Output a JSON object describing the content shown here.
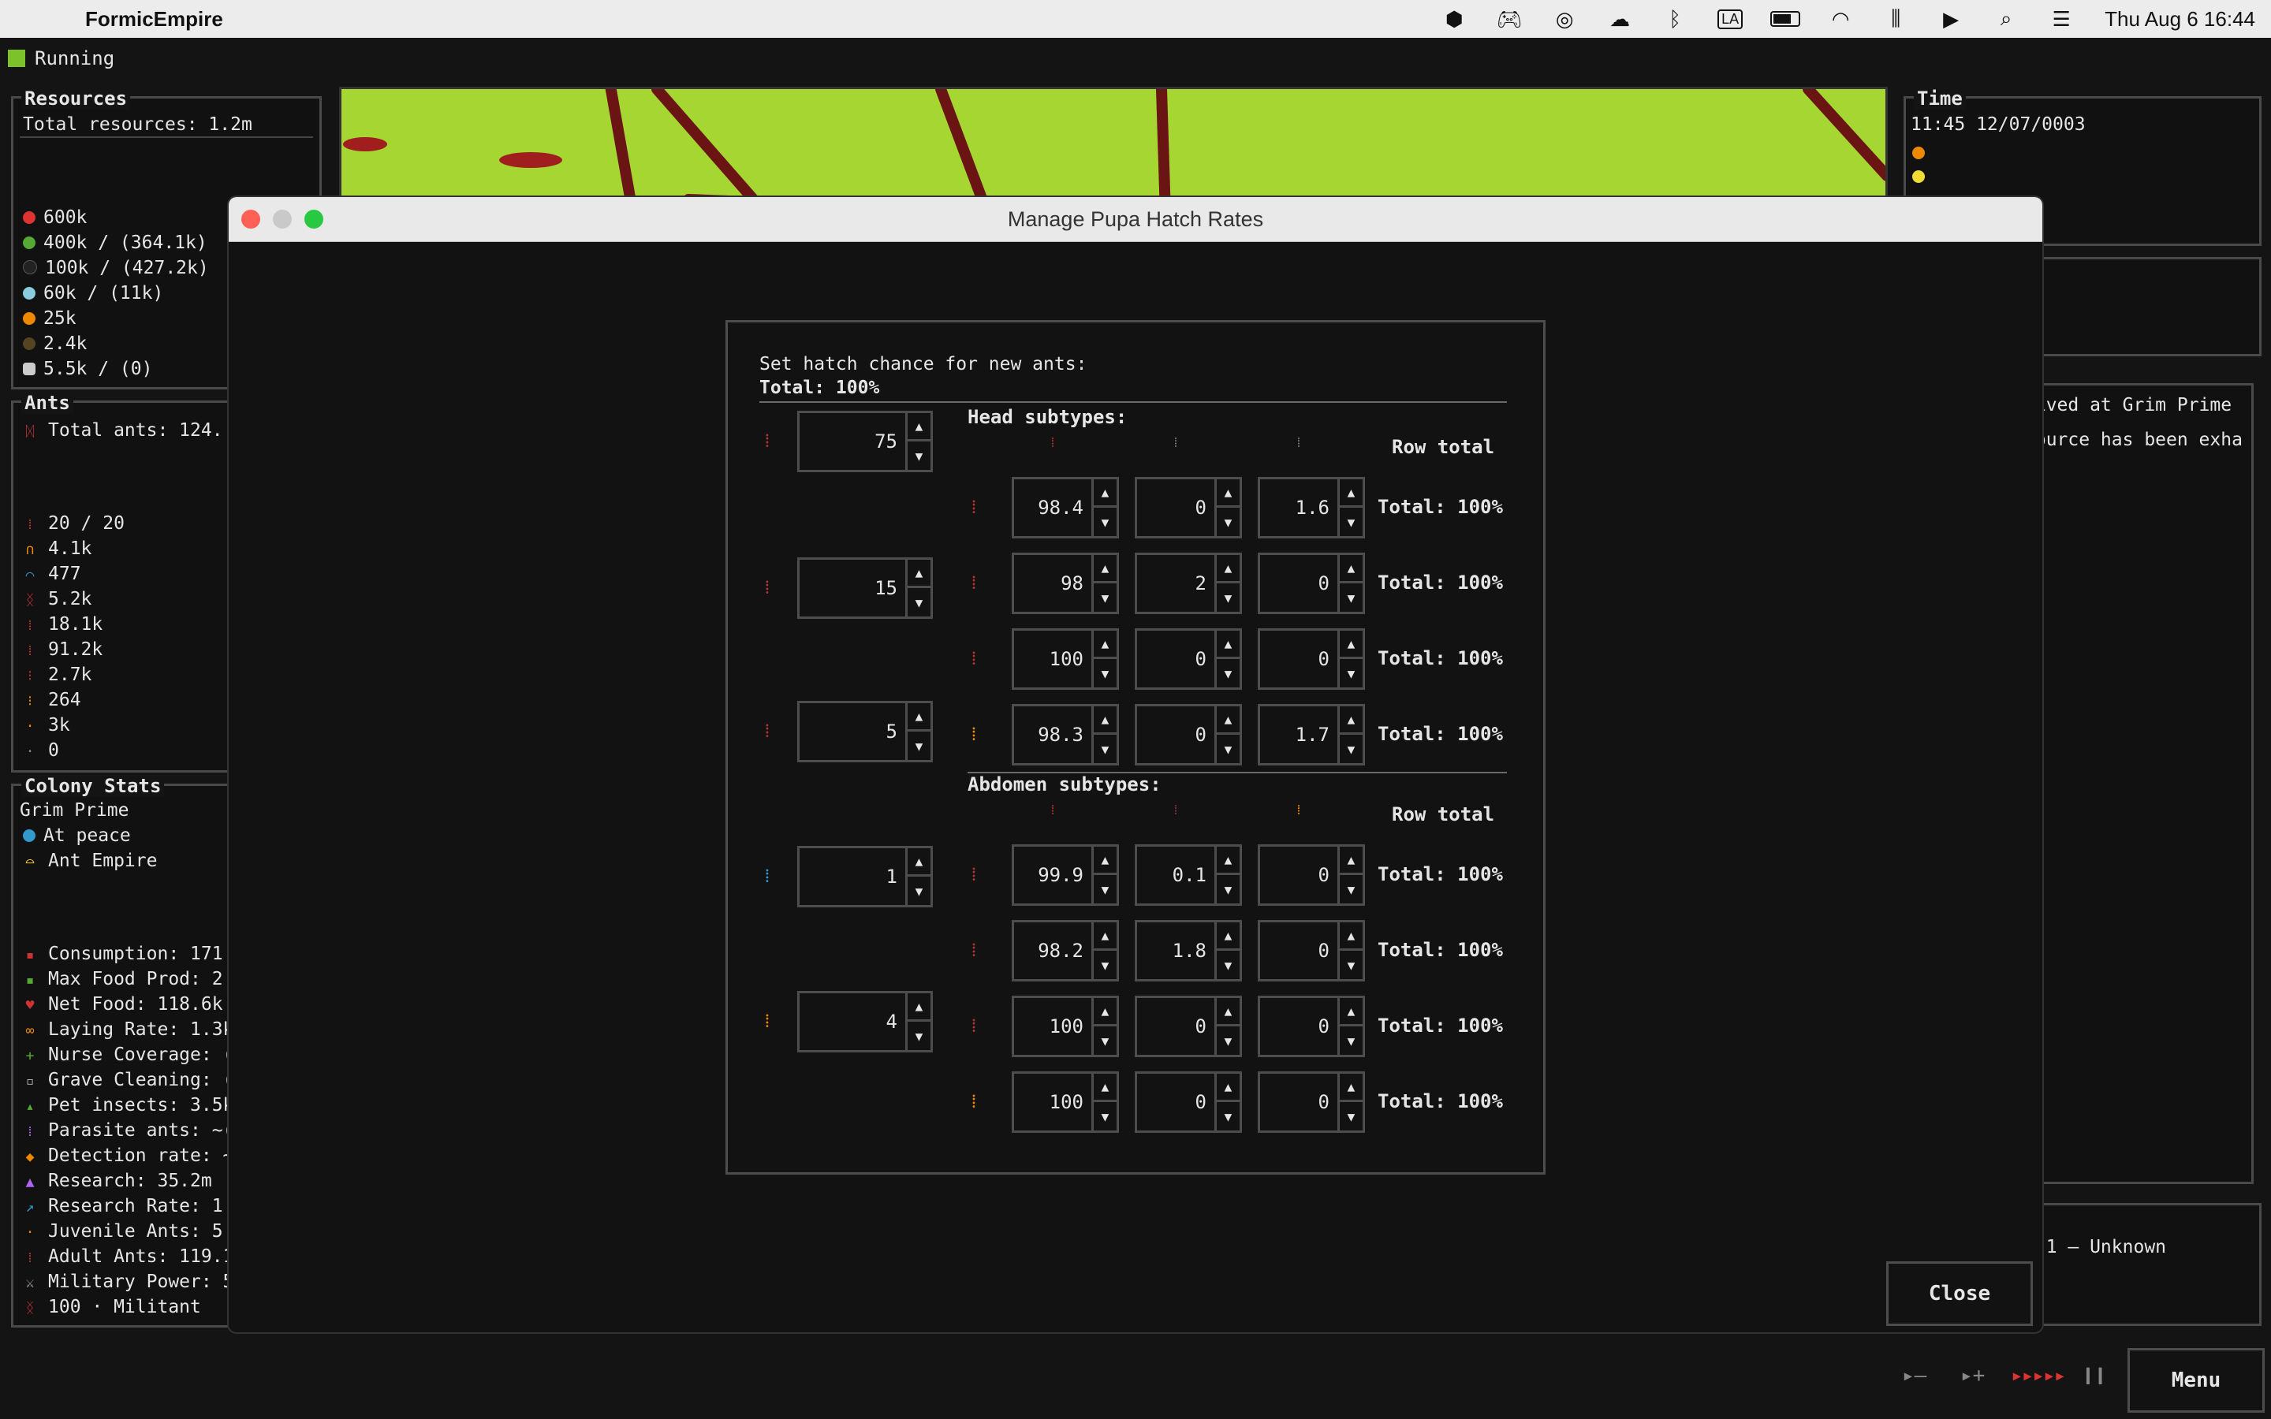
{
  "menubar": {
    "app_name": "FormicEmpire",
    "clock": "Thu Aug 6  16:44",
    "icons": [
      "cube-icon",
      "gamepad-icon",
      "airdrop-icon",
      "weather-icon",
      "bluetooth-icon",
      "input-source-icon",
      "battery-icon",
      "wifi-icon",
      "airpods-icon",
      "play-icon",
      "search-icon",
      "control-center-icon"
    ],
    "input_source": "LA"
  },
  "status": {
    "label": "Running",
    "color": "#7cc22a"
  },
  "resources": {
    "title": "Resources",
    "total": "Total resources: 1.2m",
    "items": [
      "600k",
      "400k / (364.1k)",
      "100k / (427.2k)",
      "60k / (11k)",
      "25k",
      "2.4k",
      "5.5k / (0)"
    ],
    "item_colors": [
      "#d33",
      "#5a3",
      "#222",
      "#8cd",
      "#e80",
      "#542",
      "#ccc"
    ]
  },
  "ants": {
    "title": "Ants",
    "total": "Total ants: 124.",
    "items": [
      "20 / 20",
      "4.1k",
      "477",
      "5.2k",
      "18.1k",
      "91.2k",
      "2.7k",
      "264",
      "3k",
      "0"
    ]
  },
  "colony": {
    "title": "Colony Stats",
    "name": "Grim Prime",
    "state": "At peace",
    "empire": "Ant Empire",
    "stats": [
      "Consumption: 171",
      "Max Food Prod: 2",
      "Net Food: 118.6k",
      "Laying Rate: 1.3k",
      "Nurse Coverage: (",
      "Grave Cleaning: (",
      "Pet insects: 3.5k",
      "Parasite ants: ~(",
      "Detection rate: ~",
      "Research: 35.2m",
      "Research Rate: 1",
      "Juvenile Ants: 5",
      "Adult Ants: 119.1",
      "Military Power: 5",
      "100 · Militant"
    ]
  },
  "time": {
    "title": "Time",
    "value": "11:45 12/07/0003"
  },
  "log": {
    "lines": [
      "rived at Grim Prime",
      "source has been exha"
    ]
  },
  "music": {
    "track": "e 1 — Unknown"
  },
  "dialog": {
    "title": "Manage Pupa Hatch Rates",
    "intro": "Set hatch chance for new ants:",
    "total": "Total: 100%",
    "left_values": [
      "75",
      "15",
      "5",
      "1",
      "4"
    ],
    "head_label": "Head subtypes:",
    "abdomen_label": "Abdomen subtypes:",
    "row_total_header": "Row total",
    "head_rows": [
      {
        "values": [
          "98.4",
          "0",
          "1.6"
        ],
        "total": "Total: 100%"
      },
      {
        "values": [
          "98",
          "2",
          "0"
        ],
        "total": "Total: 100%"
      },
      {
        "values": [
          "100",
          "0",
          "0"
        ],
        "total": "Total: 100%"
      },
      {
        "values": [
          "98.3",
          "0",
          "1.7"
        ],
        "total": "Total: 100%"
      }
    ],
    "abdomen_rows": [
      {
        "values": [
          "99.9",
          "0.1",
          "0"
        ],
        "total": "Total: 100%"
      },
      {
        "values": [
          "98.2",
          "1.8",
          "0"
        ],
        "total": "Total: 100%"
      },
      {
        "values": [
          "100",
          "0",
          "0"
        ],
        "total": "Total: 100%"
      },
      {
        "values": [
          "100",
          "0",
          "0"
        ],
        "total": "Total: 100%"
      }
    ],
    "spin_up": "▲",
    "spin_down": "▼",
    "close_label": "Close"
  },
  "bottom": {
    "menu_label": "Menu"
  }
}
